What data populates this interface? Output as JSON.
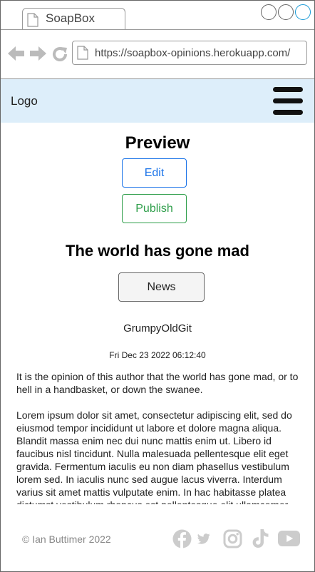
{
  "browser": {
    "tab_title": "SoapBox",
    "url": "https://soapbox-opinions.herokuapp.com/"
  },
  "header": {
    "logo": "Logo"
  },
  "main": {
    "title": "Preview",
    "edit_label": "Edit",
    "publish_label": "Publish",
    "post_title": "The world has gone mad",
    "category": "News",
    "author": "GrumpyOldGit",
    "timestamp": "Fri Dec 23 2022 06:12:40",
    "paragraphs": [
      "It is the opinion of this author that the world has gone mad, or to hell in a handbasket, or down the swanee.",
      "Lorem ipsum dolor sit amet, consectetur adipiscing elit, sed do eiusmod tempor incididunt ut labore et dolore magna aliqua. Blandit massa enim nec dui nunc mattis enim ut. Libero id faucibus nisl tincidunt. Nulla malesuada pellentesque elit eget gravida. Fermentum iaculis eu non diam phasellus vestibulum lorem sed. In iaculis nunc sed augue lacus viverra. Interdum varius sit amet mattis vulputate enim. In hac habitasse platea dictumst vestibulum rhoncus est pellentesque elit ullamcorper dignissim."
    ]
  },
  "footer": {
    "copyright": "© Ian Buttimer 2022",
    "social_icons": [
      "facebook-icon",
      "twitter-icon",
      "instagram-icon",
      "tiktok-icon",
      "youtube-icon"
    ],
    "icon_color": "#cccccc"
  },
  "colors": {
    "header_bg": "#ddeefa",
    "edit": "#1a73e8",
    "publish": "#2e9e4a",
    "close_button": "#1a9bd7"
  }
}
